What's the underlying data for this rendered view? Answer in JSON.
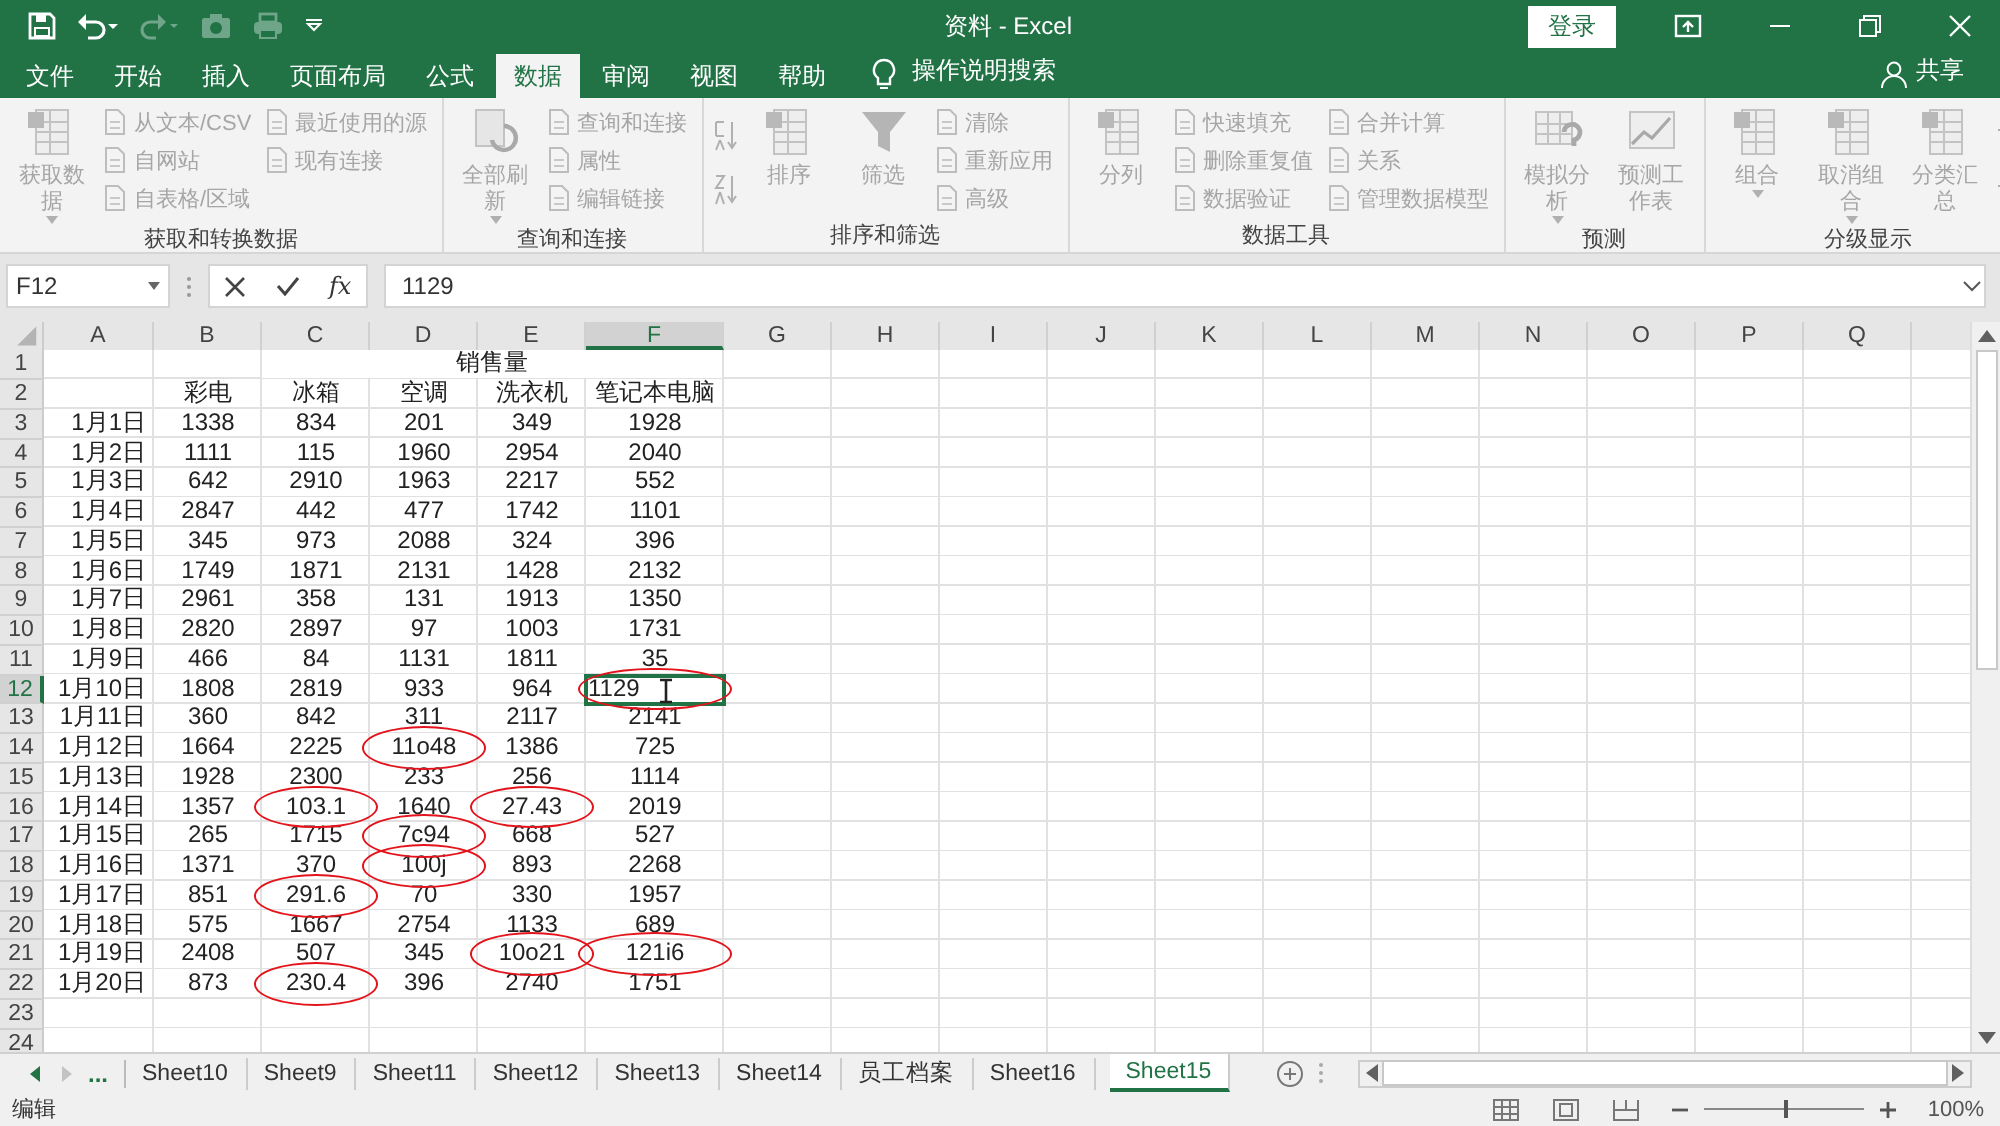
{
  "window": {
    "title": "资料 - Excel",
    "signin": "登录"
  },
  "menu_tabs": [
    {
      "label": "文件",
      "selected": false
    },
    {
      "label": "开始",
      "selected": false
    },
    {
      "label": "插入",
      "selected": false
    },
    {
      "label": "页面布局",
      "selected": false
    },
    {
      "label": "公式",
      "selected": false
    },
    {
      "label": "数据",
      "selected": true
    },
    {
      "label": "审阅",
      "selected": false
    },
    {
      "label": "视图",
      "selected": false
    },
    {
      "label": "帮助",
      "selected": false
    }
  ],
  "tell_me": "操作说明搜索",
  "share": "共享",
  "ribbon": {
    "disabled": true,
    "groups": [
      {
        "label": "获取和转换数据",
        "items": [
          {
            "kind": "large",
            "label": "获取数据",
            "dropdown": true
          },
          {
            "kind": "small",
            "label": "从文本/CSV"
          },
          {
            "kind": "small",
            "label": "自网站"
          },
          {
            "kind": "small",
            "label": "自表格/区域"
          },
          {
            "kind": "small",
            "label": "最近使用的源"
          },
          {
            "kind": "small",
            "label": "现有连接"
          }
        ]
      },
      {
        "label": "查询和连接",
        "items": [
          {
            "kind": "large",
            "label": "全部刷新",
            "dropdown": true
          },
          {
            "kind": "small",
            "label": "查询和连接"
          },
          {
            "kind": "small",
            "label": "属性"
          },
          {
            "kind": "small",
            "label": "编辑链接"
          }
        ]
      },
      {
        "label": "排序和筛选",
        "items": [
          {
            "kind": "sort"
          },
          {
            "kind": "large",
            "label": "排序",
            "dropdown": false
          },
          {
            "kind": "large",
            "label": "筛选",
            "dropdown": false
          },
          {
            "kind": "small",
            "label": "清除"
          },
          {
            "kind": "small",
            "label": "重新应用"
          },
          {
            "kind": "small",
            "label": "高级"
          }
        ]
      },
      {
        "label": "数据工具",
        "items": [
          {
            "kind": "large",
            "label": "分列",
            "dropdown": false
          },
          {
            "kind": "small",
            "label": "快速填充"
          },
          {
            "kind": "small",
            "label": "删除重复值"
          },
          {
            "kind": "small",
            "label": "数据验证"
          },
          {
            "kind": "small",
            "label": "合并计算"
          },
          {
            "kind": "small",
            "label": "关系"
          },
          {
            "kind": "small",
            "label": "管理数据模型"
          }
        ]
      },
      {
        "label": "预测",
        "items": [
          {
            "kind": "large",
            "label": "模拟分析",
            "dropdown": true
          },
          {
            "kind": "large",
            "label": "预测工作表",
            "dropdown": false
          }
        ]
      },
      {
        "label": "分级显示",
        "items": [
          {
            "kind": "large",
            "label": "组合",
            "dropdown": true
          },
          {
            "kind": "large",
            "label": "取消组合",
            "dropdown": true
          },
          {
            "kind": "large",
            "label": "分类汇总",
            "dropdown": false
          },
          {
            "kind": "detail"
          }
        ]
      }
    ]
  },
  "formula_bar": {
    "name_box": "F12",
    "function_button": "fx",
    "value": "1129"
  },
  "columns": [
    {
      "label": "A",
      "selected": false
    },
    {
      "label": "B",
      "selected": false
    },
    {
      "label": "C",
      "selected": false
    },
    {
      "label": "D",
      "selected": false
    },
    {
      "label": "E",
      "selected": false
    },
    {
      "label": "F",
      "selected": true
    },
    {
      "label": "G",
      "selected": false
    },
    {
      "label": "H",
      "selected": false
    },
    {
      "label": "I",
      "selected": false
    },
    {
      "label": "J",
      "selected": false
    },
    {
      "label": "K",
      "selected": false
    },
    {
      "label": "L",
      "selected": false
    },
    {
      "label": "M",
      "selected": false
    },
    {
      "label": "N",
      "selected": false
    },
    {
      "label": "O",
      "selected": false
    },
    {
      "label": "P",
      "selected": false
    },
    {
      "label": "Q",
      "selected": false
    }
  ],
  "rows": [
    {
      "header": "1",
      "kind": "title",
      "selected": false,
      "title": "销售量"
    },
    {
      "header": "2",
      "kind": "header",
      "selected": false,
      "cells": [
        "彩电",
        "冰箱",
        "空调",
        "洗衣机",
        "笔记本电脑"
      ]
    },
    {
      "header": "3",
      "kind": "data",
      "selected": false,
      "cells": [
        {
          "text": "1月1日",
          "circled": false,
          "selected": false
        },
        {
          "text": "1338",
          "circled": false,
          "selected": false
        },
        {
          "text": "834",
          "circled": false,
          "selected": false
        },
        {
          "text": "201",
          "circled": false,
          "selected": false
        },
        {
          "text": "349",
          "circled": false,
          "selected": false
        },
        {
          "text": "1928",
          "circled": false,
          "selected": false
        }
      ]
    },
    {
      "header": "4",
      "kind": "data",
      "selected": false,
      "cells": [
        {
          "text": "1月2日",
          "circled": false,
          "selected": false
        },
        {
          "text": "1111",
          "circled": false,
          "selected": false
        },
        {
          "text": "115",
          "circled": false,
          "selected": false
        },
        {
          "text": "1960",
          "circled": false,
          "selected": false
        },
        {
          "text": "2954",
          "circled": false,
          "selected": false
        },
        {
          "text": "2040",
          "circled": false,
          "selected": false
        }
      ]
    },
    {
      "header": "5",
      "kind": "data",
      "selected": false,
      "cells": [
        {
          "text": "1月3日",
          "circled": false,
          "selected": false
        },
        {
          "text": "642",
          "circled": false,
          "selected": false
        },
        {
          "text": "2910",
          "circled": false,
          "selected": false
        },
        {
          "text": "1963",
          "circled": false,
          "selected": false
        },
        {
          "text": "2217",
          "circled": false,
          "selected": false
        },
        {
          "text": "552",
          "circled": false,
          "selected": false
        }
      ]
    },
    {
      "header": "6",
      "kind": "data",
      "selected": false,
      "cells": [
        {
          "text": "1月4日",
          "circled": false,
          "selected": false
        },
        {
          "text": "2847",
          "circled": false,
          "selected": false
        },
        {
          "text": "442",
          "circled": false,
          "selected": false
        },
        {
          "text": "477",
          "circled": false,
          "selected": false
        },
        {
          "text": "1742",
          "circled": false,
          "selected": false
        },
        {
          "text": "1101",
          "circled": false,
          "selected": false
        }
      ]
    },
    {
      "header": "7",
      "kind": "data",
      "selected": false,
      "cells": [
        {
          "text": "1月5日",
          "circled": false,
          "selected": false
        },
        {
          "text": "345",
          "circled": false,
          "selected": false
        },
        {
          "text": "973",
          "circled": false,
          "selected": false
        },
        {
          "text": "2088",
          "circled": false,
          "selected": false
        },
        {
          "text": "324",
          "circled": false,
          "selected": false
        },
        {
          "text": "396",
          "circled": false,
          "selected": false
        }
      ]
    },
    {
      "header": "8",
      "kind": "data",
      "selected": false,
      "cells": [
        {
          "text": "1月6日",
          "circled": false,
          "selected": false
        },
        {
          "text": "1749",
          "circled": false,
          "selected": false
        },
        {
          "text": "1871",
          "circled": false,
          "selected": false
        },
        {
          "text": "2131",
          "circled": false,
          "selected": false
        },
        {
          "text": "1428",
          "circled": false,
          "selected": false
        },
        {
          "text": "2132",
          "circled": false,
          "selected": false
        }
      ]
    },
    {
      "header": "9",
      "kind": "data",
      "selected": false,
      "cells": [
        {
          "text": "1月7日",
          "circled": false,
          "selected": false
        },
        {
          "text": "2961",
          "circled": false,
          "selected": false
        },
        {
          "text": "358",
          "circled": false,
          "selected": false
        },
        {
          "text": "131",
          "circled": false,
          "selected": false
        },
        {
          "text": "1913",
          "circled": false,
          "selected": false
        },
        {
          "text": "1350",
          "circled": false,
          "selected": false
        }
      ]
    },
    {
      "header": "10",
      "kind": "data",
      "selected": false,
      "cells": [
        {
          "text": "1月8日",
          "circled": false,
          "selected": false
        },
        {
          "text": "2820",
          "circled": false,
          "selected": false
        },
        {
          "text": "2897",
          "circled": false,
          "selected": false
        },
        {
          "text": "97",
          "circled": false,
          "selected": false
        },
        {
          "text": "1003",
          "circled": false,
          "selected": false
        },
        {
          "text": "1731",
          "circled": false,
          "selected": false
        }
      ]
    },
    {
      "header": "11",
      "kind": "data",
      "selected": false,
      "cells": [
        {
          "text": "1月9日",
          "circled": false,
          "selected": false
        },
        {
          "text": "466",
          "circled": false,
          "selected": false
        },
        {
          "text": "84",
          "circled": false,
          "selected": false
        },
        {
          "text": "1131",
          "circled": false,
          "selected": false
        },
        {
          "text": "1811",
          "circled": false,
          "selected": false
        },
        {
          "text": "35",
          "circled": false,
          "selected": false
        }
      ]
    },
    {
      "header": "12",
      "kind": "data",
      "selected": true,
      "cells": [
        {
          "text": "1月10日",
          "circled": false,
          "selected": false
        },
        {
          "text": "1808",
          "circled": false,
          "selected": false
        },
        {
          "text": "2819",
          "circled": false,
          "selected": false
        },
        {
          "text": "933",
          "circled": false,
          "selected": false
        },
        {
          "text": "964",
          "circled": false,
          "selected": false
        },
        {
          "text": "1129",
          "circled": true,
          "selected": true
        }
      ]
    },
    {
      "header": "13",
      "kind": "data",
      "selected": false,
      "cells": [
        {
          "text": "1月11日",
          "circled": false,
          "selected": false
        },
        {
          "text": "360",
          "circled": false,
          "selected": false
        },
        {
          "text": "842",
          "circled": false,
          "selected": false
        },
        {
          "text": "311",
          "circled": false,
          "selected": false
        },
        {
          "text": "2117",
          "circled": false,
          "selected": false
        },
        {
          "text": "2141",
          "circled": false,
          "selected": false
        }
      ]
    },
    {
      "header": "14",
      "kind": "data",
      "selected": false,
      "cells": [
        {
          "text": "1月12日",
          "circled": false,
          "selected": false
        },
        {
          "text": "1664",
          "circled": false,
          "selected": false
        },
        {
          "text": "2225",
          "circled": false,
          "selected": false
        },
        {
          "text": "11o48",
          "circled": true,
          "selected": false
        },
        {
          "text": "1386",
          "circled": false,
          "selected": false
        },
        {
          "text": "725",
          "circled": false,
          "selected": false
        }
      ]
    },
    {
      "header": "15",
      "kind": "data",
      "selected": false,
      "cells": [
        {
          "text": "1月13日",
          "circled": false,
          "selected": false
        },
        {
          "text": "1928",
          "circled": false,
          "selected": false
        },
        {
          "text": "2300",
          "circled": false,
          "selected": false
        },
        {
          "text": "233",
          "circled": false,
          "selected": false
        },
        {
          "text": "256",
          "circled": false,
          "selected": false
        },
        {
          "text": "1114",
          "circled": false,
          "selected": false
        }
      ]
    },
    {
      "header": "16",
      "kind": "data",
      "selected": false,
      "cells": [
        {
          "text": "1月14日",
          "circled": false,
          "selected": false
        },
        {
          "text": "1357",
          "circled": false,
          "selected": false
        },
        {
          "text": "103.1",
          "circled": true,
          "selected": false
        },
        {
          "text": "1640",
          "circled": false,
          "selected": false
        },
        {
          "text": "27.43",
          "circled": true,
          "selected": false
        },
        {
          "text": "2019",
          "circled": false,
          "selected": false
        }
      ]
    },
    {
      "header": "17",
      "kind": "data",
      "selected": false,
      "cells": [
        {
          "text": "1月15日",
          "circled": false,
          "selected": false
        },
        {
          "text": "265",
          "circled": false,
          "selected": false
        },
        {
          "text": "1715",
          "circled": false,
          "selected": false
        },
        {
          "text": "7c94",
          "circled": true,
          "selected": false
        },
        {
          "text": "668",
          "circled": false,
          "selected": false
        },
        {
          "text": "527",
          "circled": false,
          "selected": false
        }
      ]
    },
    {
      "header": "18",
      "kind": "data",
      "selected": false,
      "cells": [
        {
          "text": "1月16日",
          "circled": false,
          "selected": false
        },
        {
          "text": "1371",
          "circled": false,
          "selected": false
        },
        {
          "text": "370",
          "circled": false,
          "selected": false
        },
        {
          "text": "100j",
          "circled": true,
          "selected": false
        },
        {
          "text": "893",
          "circled": false,
          "selected": false
        },
        {
          "text": "2268",
          "circled": false,
          "selected": false
        }
      ]
    },
    {
      "header": "19",
      "kind": "data",
      "selected": false,
      "cells": [
        {
          "text": "1月17日",
          "circled": false,
          "selected": false
        },
        {
          "text": "851",
          "circled": false,
          "selected": false
        },
        {
          "text": "291.6",
          "circled": true,
          "selected": false
        },
        {
          "text": "70",
          "circled": false,
          "selected": false
        },
        {
          "text": "330",
          "circled": false,
          "selected": false
        },
        {
          "text": "1957",
          "circled": false,
          "selected": false
        }
      ]
    },
    {
      "header": "20",
      "kind": "data",
      "selected": false,
      "cells": [
        {
          "text": "1月18日",
          "circled": false,
          "selected": false
        },
        {
          "text": "575",
          "circled": false,
          "selected": false
        },
        {
          "text": "1667",
          "circled": false,
          "selected": false
        },
        {
          "text": "2754",
          "circled": false,
          "selected": false
        },
        {
          "text": "1133",
          "circled": false,
          "selected": false
        },
        {
          "text": "689",
          "circled": false,
          "selected": false
        }
      ]
    },
    {
      "header": "21",
      "kind": "data",
      "selected": false,
      "cells": [
        {
          "text": "1月19日",
          "circled": false,
          "selected": false
        },
        {
          "text": "2408",
          "circled": false,
          "selected": false
        },
        {
          "text": "507",
          "circled": false,
          "selected": false
        },
        {
          "text": "345",
          "circled": false,
          "selected": false
        },
        {
          "text": "10o21",
          "circled": true,
          "selected": false
        },
        {
          "text": "121i6",
          "circled": true,
          "selected": false
        }
      ]
    },
    {
      "header": "22",
      "kind": "data",
      "selected": false,
      "cells": [
        {
          "text": "1月20日",
          "circled": false,
          "selected": false
        },
        {
          "text": "873",
          "circled": false,
          "selected": false
        },
        {
          "text": "230.4",
          "circled": true,
          "selected": false
        },
        {
          "text": "396",
          "circled": false,
          "selected": false
        },
        {
          "text": "2740",
          "circled": false,
          "selected": false
        },
        {
          "text": "1751",
          "circled": false,
          "selected": false
        }
      ]
    },
    {
      "header": "23",
      "kind": "empty",
      "selected": false
    },
    {
      "header": "24",
      "kind": "empty",
      "selected": false
    }
  ],
  "sheet_tabs": {
    "more": "...",
    "tabs": [
      {
        "label": "Sheet10",
        "selected": false
      },
      {
        "label": "Sheet9",
        "selected": false
      },
      {
        "label": "Sheet11",
        "selected": false
      },
      {
        "label": "Sheet12",
        "selected": false
      },
      {
        "label": "Sheet13",
        "selected": false
      },
      {
        "label": "Sheet14",
        "selected": false
      },
      {
        "label": "员工档案",
        "selected": false
      },
      {
        "label": "Sheet16",
        "selected": false
      },
      {
        "label": "Sheet15",
        "selected": true
      }
    ]
  },
  "status_bar": {
    "mode": "编辑",
    "zoom": {
      "level": 0.5,
      "reading": "100%"
    }
  }
}
